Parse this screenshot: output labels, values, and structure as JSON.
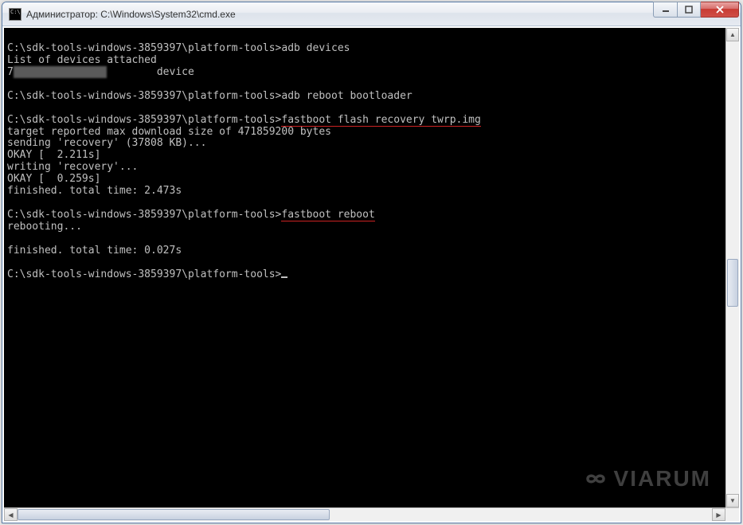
{
  "window": {
    "title": "Администратор: C:\\Windows\\System32\\cmd.exe"
  },
  "console": {
    "prompt": "C:\\sdk-tools-windows-3859397\\platform-tools>",
    "cmd1": "adb devices",
    "out1_l1": "List of devices attached",
    "out1_serial_prefix": "7",
    "out1_serial_masked": "xxxxxxxxxxxxxxx",
    "out1_status": "device",
    "cmd2": "adb reboot bootloader",
    "cmd3": "fastboot flash recovery twrp.img",
    "out3_l1": "target reported max download size of 471859200 bytes",
    "out3_l2": "sending 'recovery' (37808 KB)...",
    "out3_l3": "OKAY [  2.211s]",
    "out3_l4": "writing 'recovery'...",
    "out3_l5": "OKAY [  0.259s]",
    "out3_l6": "finished. total time: 2.473s",
    "cmd4": "fastboot reboot",
    "out4_l1": "rebooting...",
    "out4_l2": "",
    "out4_l3": "finished. total time: 0.027s"
  },
  "watermark": {
    "text": "VIARUM"
  }
}
